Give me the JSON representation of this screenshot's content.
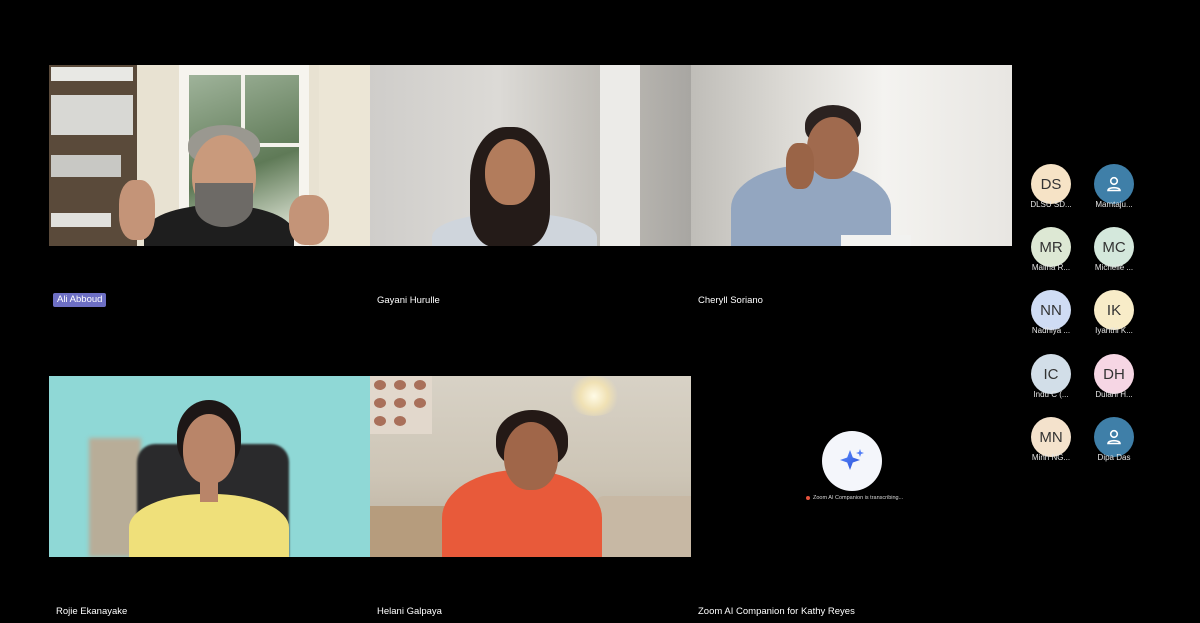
{
  "video_tiles": [
    {
      "name": "Ali Abboud",
      "active_speaker": true
    },
    {
      "name": "Gayani Hurulle",
      "active_speaker": false
    },
    {
      "name": "Cheryll Soriano",
      "active_speaker": false
    },
    {
      "name": "Rojie Ekanayake",
      "active_speaker": false
    },
    {
      "name": "Helani Galpaya",
      "active_speaker": false
    },
    {
      "name": "Zoom AI Companion for Kathy Reyes",
      "active_speaker": false,
      "status": "Zoom AI Companion is transcribing..."
    }
  ],
  "participants": [
    {
      "initials": "DS",
      "name": "DLSU SD...",
      "color": "#f6e3c6"
    },
    {
      "initials": "",
      "icon": "person-icon",
      "name": "Mamtaju...",
      "color": "#3f7fa8"
    },
    {
      "initials": "MR",
      "name": "Maliha R...",
      "color": "#dde8d4"
    },
    {
      "initials": "MC",
      "name": "Michelle ...",
      "color": "#d4e8dc"
    },
    {
      "initials": "NN",
      "name": "Nadhiya ...",
      "color": "#cfdcf4"
    },
    {
      "initials": "IK",
      "name": "Iyanthi K...",
      "color": "#f8ecc8"
    },
    {
      "initials": "IC",
      "name": "Indu C (...",
      "color": "#d2dee8"
    },
    {
      "initials": "DH",
      "name": "Dulani H...",
      "color": "#f6d6e4"
    },
    {
      "initials": "MN",
      "name": "Minh NG...",
      "color": "#f4e2cc"
    },
    {
      "initials": "",
      "icon": "person-icon",
      "name": "Dipa Das",
      "color": "#3f7fa8"
    }
  ],
  "colors": {
    "active_speaker_label": "#6d6fc4",
    "background": "#000000"
  }
}
